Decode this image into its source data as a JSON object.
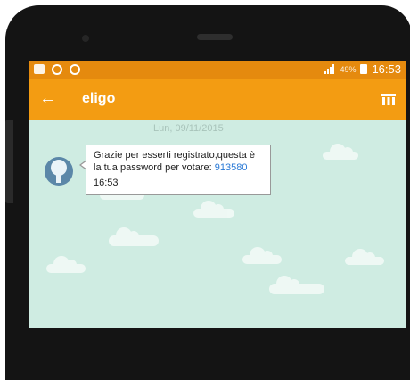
{
  "status_bar": {
    "battery_percent": "49%",
    "time": "16:53",
    "left_icons": [
      "notification-icon",
      "whatsapp-icon",
      "app-icon"
    ]
  },
  "toolbar": {
    "back_icon": "arrow-left-icon",
    "title": "eligo",
    "action_icon": "menu-icon"
  },
  "chat": {
    "date_divider": "Lun, 09/11/2015",
    "message": {
      "text": "Grazie per esserti registrato,questa è la tua password per votare:",
      "password": "913580",
      "time": "16:53"
    }
  },
  "colors": {
    "status_bar": "#e58a0e",
    "toolbar": "#f39c12",
    "chat_background": "#cfece2",
    "link": "#2979d6"
  }
}
